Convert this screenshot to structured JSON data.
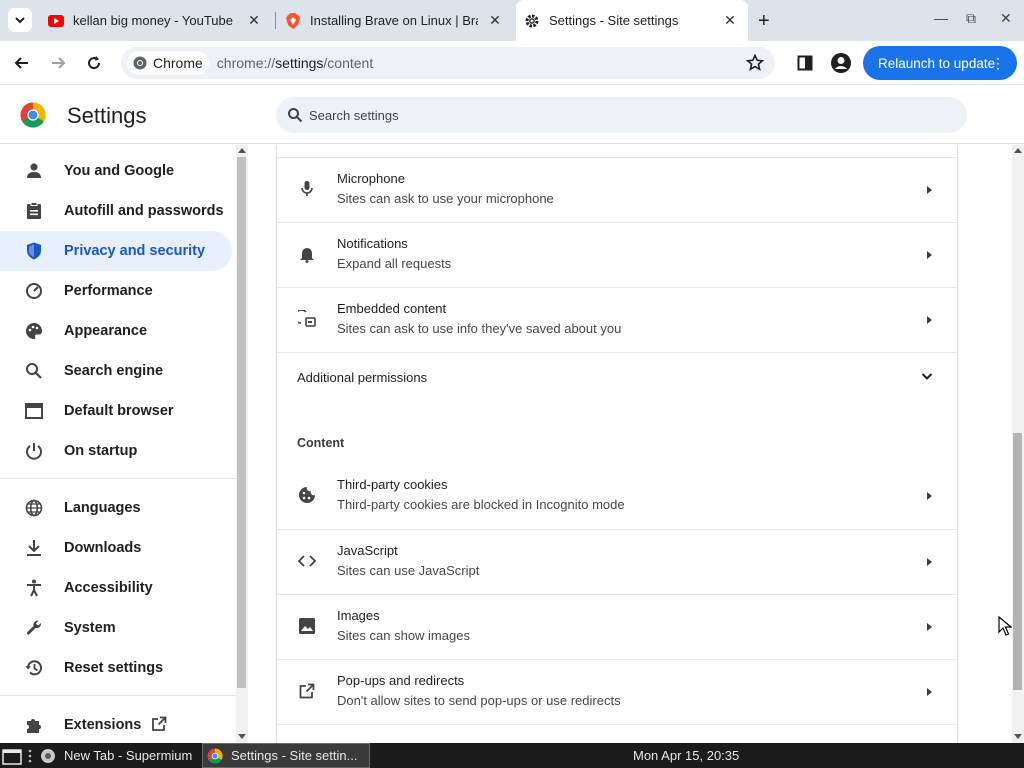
{
  "browser": {
    "tabs": [
      {
        "title": "kellan big money - YouTube",
        "favicon": "youtube-icon"
      },
      {
        "title": "Installing Brave on Linux | Bra",
        "favicon": "brave-icon"
      },
      {
        "title": "Settings - Site settings",
        "favicon": "settings-gear-icon",
        "active": true
      }
    ],
    "omnibox": {
      "chip": "Chrome",
      "url_prefix": "chrome://",
      "url_host": "settings",
      "url_path": "/content"
    },
    "relaunch_label": "Relaunch to update"
  },
  "settings": {
    "title": "Settings",
    "search_placeholder": "Search settings",
    "nav": [
      {
        "label": "You and Google",
        "icon": "person-icon"
      },
      {
        "label": "Autofill and passwords",
        "icon": "clipboard-icon"
      },
      {
        "label": "Privacy and security",
        "icon": "shield-icon",
        "active": true
      },
      {
        "label": "Performance",
        "icon": "speedometer-icon"
      },
      {
        "label": "Appearance",
        "icon": "palette-icon"
      },
      {
        "label": "Search engine",
        "icon": "search-icon"
      },
      {
        "label": "Default browser",
        "icon": "browser-window-icon"
      },
      {
        "label": "On startup",
        "icon": "power-icon"
      },
      {
        "label": "Languages",
        "icon": "globe-icon"
      },
      {
        "label": "Downloads",
        "icon": "download-icon"
      },
      {
        "label": "Accessibility",
        "icon": "accessibility-icon"
      },
      {
        "label": "System",
        "icon": "wrench-icon"
      },
      {
        "label": "Reset settings",
        "icon": "history-icon"
      },
      {
        "label": "Extensions",
        "icon": "puzzle-icon"
      }
    ],
    "permissions": [
      {
        "title": "Microphone",
        "subtitle": "Sites can ask to use your microphone",
        "icon": "microphone-icon"
      },
      {
        "title": "Notifications",
        "subtitle": "Expand all requests",
        "icon": "bell-icon"
      },
      {
        "title": "Embedded content",
        "subtitle": "Sites can ask to use info they've saved about you",
        "icon": "embedded-content-icon"
      }
    ],
    "additional_permissions": "Additional permissions",
    "content_section": "Content",
    "content": [
      {
        "title": "Third-party cookies",
        "subtitle": "Third-party cookies are blocked in Incognito mode",
        "icon": "cookie-icon"
      },
      {
        "title": "JavaScript",
        "subtitle": "Sites can use JavaScript",
        "icon": "code-icon"
      },
      {
        "title": "Images",
        "subtitle": "Sites can show images",
        "icon": "image-icon"
      },
      {
        "title": "Pop-ups and redirects",
        "subtitle": "Don't allow sites to send pop-ups or use redirects",
        "icon": "open-external-icon"
      }
    ]
  },
  "taskbar": {
    "items": [
      {
        "label": "New Tab - Supermium"
      },
      {
        "label": "Settings - Site settin..."
      }
    ],
    "clock": "Mon Apr 15, 20:35"
  },
  "colors": {
    "accent": "#1a73e8",
    "active_nav_bg": "#e8f0fe",
    "tabstrip": "#dde3ea"
  }
}
